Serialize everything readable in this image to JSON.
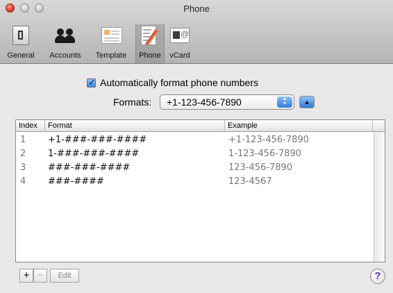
{
  "window": {
    "title": "Phone"
  },
  "toolbar": {
    "items": [
      {
        "label": "General",
        "icon": "general-switch-icon"
      },
      {
        "label": "Accounts",
        "icon": "accounts-people-icon"
      },
      {
        "label": "Template",
        "icon": "template-icon"
      },
      {
        "label": "Phone",
        "icon": "phone-format-icon",
        "selected": true
      },
      {
        "label": "vCard",
        "icon": "vcard-icon"
      }
    ]
  },
  "settings": {
    "auto_format_label": "Automatically format phone numbers",
    "auto_format_checked": true,
    "formats_label": "Formats:",
    "formats_selected": "+1-123-456-7890"
  },
  "table": {
    "headers": {
      "index": "Index",
      "format": "Format",
      "example": "Example"
    },
    "rows": [
      {
        "index": "1",
        "format": "+1-###-###-####",
        "example": "+1-123-456-7890"
      },
      {
        "index": "2",
        "format": "1-###-###-####",
        "example": "1-123-456-7890"
      },
      {
        "index": "3",
        "format": "###-###-####",
        "example": "123-456-7890"
      },
      {
        "index": "4",
        "format": "###-####",
        "example": "123-4567"
      }
    ]
  },
  "footer": {
    "add_label": "+",
    "remove_label": "−",
    "edit_label": "Edit",
    "help_label": "?"
  },
  "colors": {
    "accent": "#3d8ae0",
    "close": "#d8392b"
  }
}
